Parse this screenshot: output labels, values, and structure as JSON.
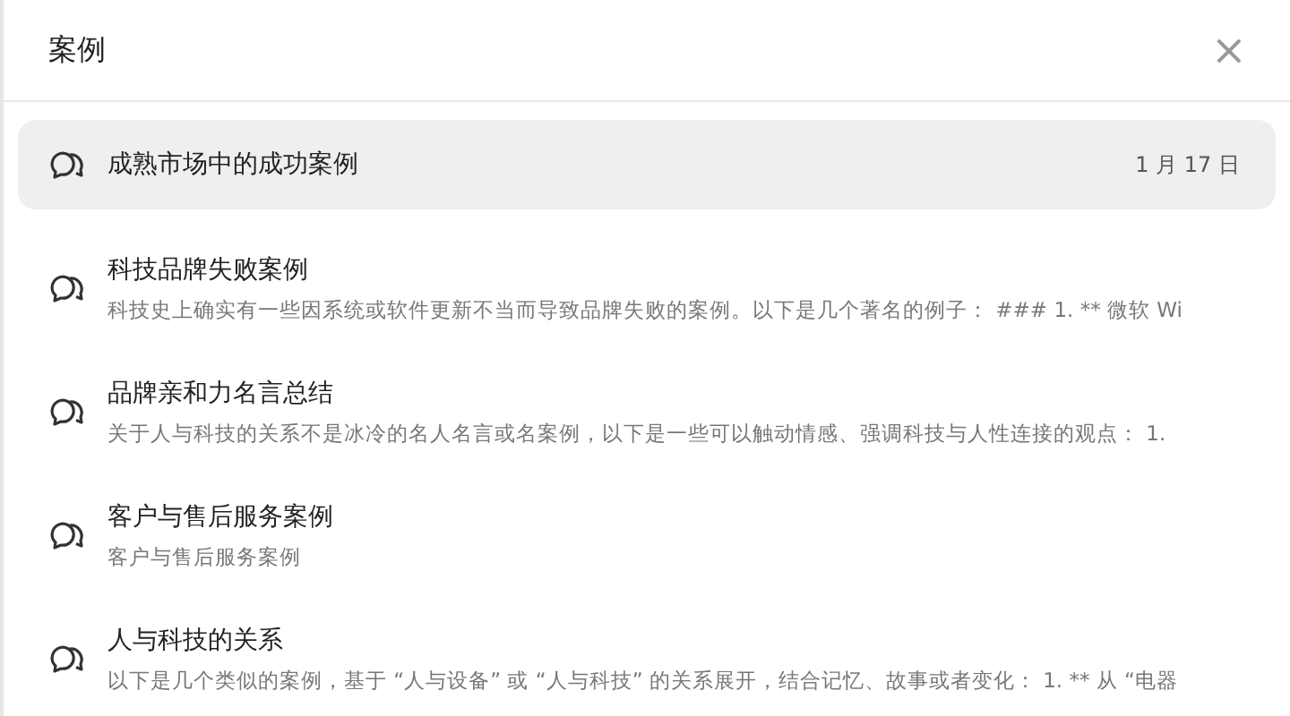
{
  "dialog": {
    "title": "案例",
    "close": "×"
  },
  "items": [
    {
      "title": "成熟市场中的成功案例",
      "date": "1 月 17 日",
      "selected": true
    },
    {
      "title": "科技品牌失败案例",
      "snippet": "科技史上确实有一些因系统或软件更新不当而导致品牌失败的案例。以下是几个著名的例子： ### 1. ** 微软 Wi",
      "selected": false
    },
    {
      "title": "品牌亲和力名言总结",
      "snippet": "关于人与科技的关系不是冰冷的名人名言或名案例，以下是一些可以触动情感、强调科技与人性连接的观点： 1.",
      "selected": false
    },
    {
      "title": "客户与售后服务案例",
      "snippet": "客户与售后服务案例",
      "selected": false
    },
    {
      "title": "人与科技的关系",
      "snippet": "以下是几个类似的案例，基于 “人与设备” 或 “人与科技” 的关系展开，结合记忆、故事或者变化： 1. ** 从 “电器",
      "selected": false
    }
  ]
}
